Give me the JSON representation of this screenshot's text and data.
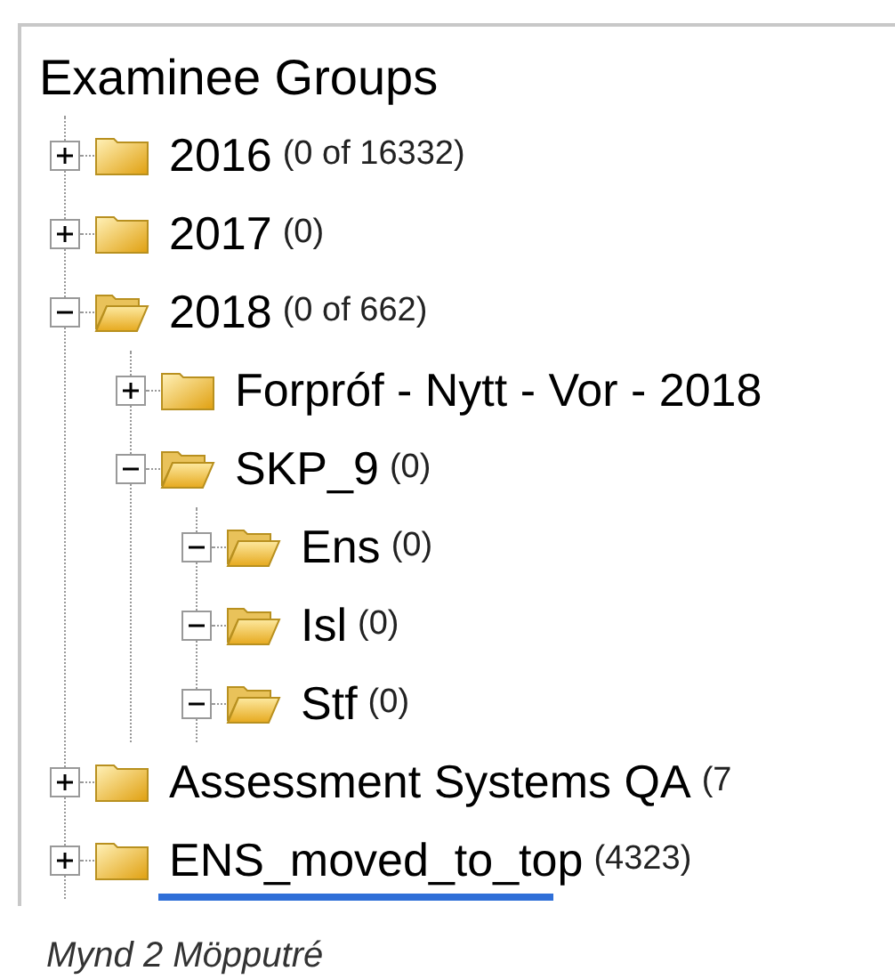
{
  "panel": {
    "title": "Examinee Groups",
    "tree": [
      {
        "label": "2016",
        "count": "(0 of 16332)",
        "expanded": false
      },
      {
        "label": "2017",
        "count": "(0)",
        "expanded": false
      },
      {
        "label": "2018",
        "count": "(0 of 662)",
        "expanded": true,
        "children": [
          {
            "label": "Forpróf - Nytt - Vor - 2018",
            "expanded": false
          },
          {
            "label": "SKP_9",
            "count": "(0)",
            "expanded": true,
            "children": [
              {
                "label": "Ens",
                "count": "(0)",
                "expanded": true
              },
              {
                "label": "Isl",
                "count": "(0)",
                "expanded": true
              },
              {
                "label": "Stf",
                "count": "(0)",
                "expanded": true
              }
            ]
          }
        ]
      },
      {
        "label": "Assessment Systems QA",
        "count": "(7",
        "expanded": false
      },
      {
        "label": "ENS_moved_to_top",
        "count": "(4323)",
        "expanded": false,
        "drop_indicator": true
      }
    ]
  },
  "caption": "Mynd 2 Möpputré"
}
